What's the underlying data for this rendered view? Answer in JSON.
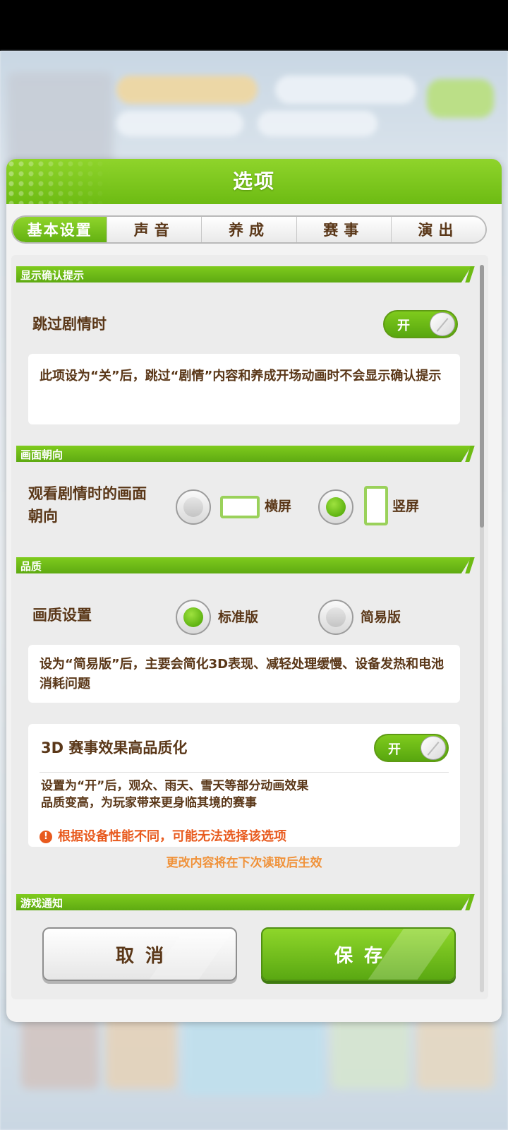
{
  "dialog": {
    "title": "选项",
    "tabs": [
      {
        "label": "基本设置",
        "active": true
      },
      {
        "label": "声音",
        "active": false
      },
      {
        "label": "养成",
        "active": false
      },
      {
        "label": "赛事",
        "active": false
      },
      {
        "label": "演出",
        "active": false
      }
    ]
  },
  "sections": {
    "confirm": {
      "header": "显示确认提示",
      "skip_story_label": "跳过剧情时",
      "skip_story_toggle": "开",
      "info": "此项设为“关”后，跳过“剧情”内容和养成开场动画时不会显示确认提示"
    },
    "orientation": {
      "header": "画面朝向",
      "label": "观看剧情时的画面朝向",
      "options": [
        {
          "label": "横屏",
          "selected": false
        },
        {
          "label": "竖屏",
          "selected": true
        }
      ]
    },
    "quality": {
      "header": "品质",
      "label": "画质设置",
      "options": [
        {
          "label": "标准版",
          "selected": true
        },
        {
          "label": "简易版",
          "selected": false
        }
      ],
      "info": "设为“简易版”后，主要会简化3D表现、减轻处理缓慢、设备发热和电池消耗问题",
      "race3d": {
        "title": "3D 赛事效果高品质化",
        "toggle": "开",
        "desc": "设置为“开”后，观众、雨天、雪天等部分动画效果品质变高，为玩家带来更身临其境的赛事",
        "warning": "根据设备性能不同，可能无法选择该选项"
      },
      "notice": "更改内容将在下次读取后生效"
    },
    "notification": {
      "header": "游戏通知"
    }
  },
  "buttons": {
    "cancel": "取消",
    "save": "保存"
  },
  "colors": {
    "accent_green": "#6dbb13",
    "text_brown": "#5a3718",
    "warning": "#e85a1e",
    "notice": "#f0923a"
  }
}
